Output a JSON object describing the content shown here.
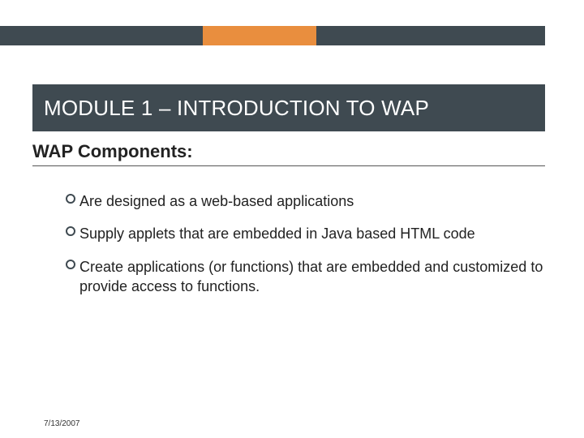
{
  "accent_dark": "#3f4a51",
  "accent_orange": "#e98e3e",
  "title": "MODULE 1 – INTRODUCTION TO WAP",
  "subtitle": "WAP Components:",
  "bullets": [
    "Are designed as a web-based applications",
    "Supply applets that are embedded in Java based HTML code",
    "Create applications (or functions) that are embedded and customized to provide access to functions."
  ],
  "footer_date": "7/13/2007"
}
